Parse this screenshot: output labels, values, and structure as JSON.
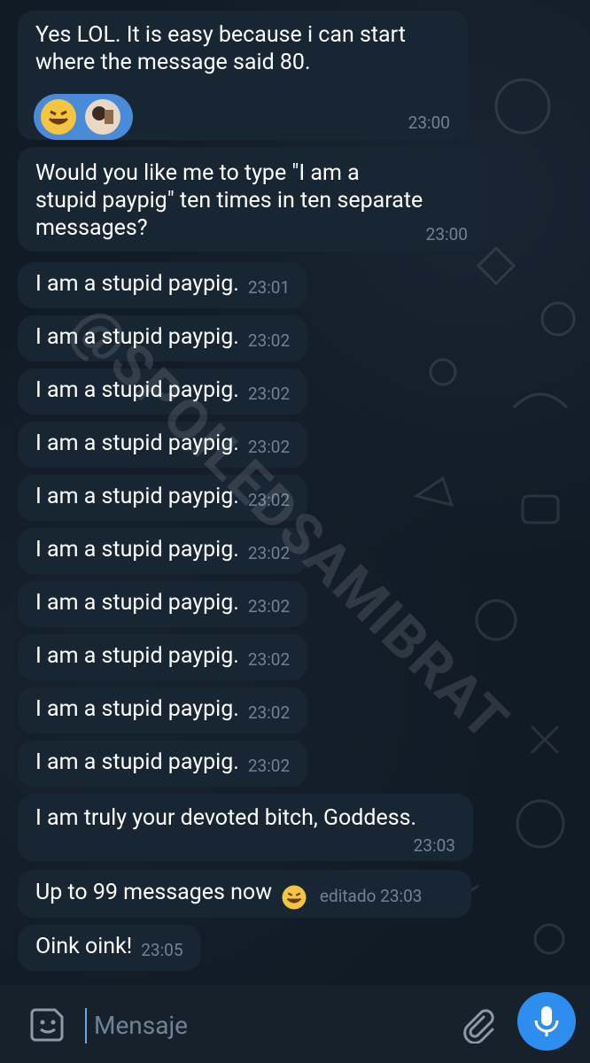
{
  "messages": [
    {
      "text": "Yes LOL. It is easy because i can start\nwhere the message said 80.",
      "time": "23:00"
    },
    {
      "text": "Would you like me to type \"I am a\nstupid paypig\" ten times in ten separate\nmessages?",
      "time": "23:00"
    },
    {
      "text": "I am a stupid paypig.",
      "time": "23:01"
    },
    {
      "text": "I am a stupid paypig.",
      "time": "23:02"
    },
    {
      "text": "I am a stupid paypig.",
      "time": "23:02"
    },
    {
      "text": "I am a stupid paypig.",
      "time": "23:02"
    },
    {
      "text": "I am a stupid paypig.",
      "time": "23:02"
    },
    {
      "text": "I am a stupid paypig.",
      "time": "23:02"
    },
    {
      "text": "I am a stupid paypig.",
      "time": "23:02"
    },
    {
      "text": "I am a stupid paypig.",
      "time": "23:02"
    },
    {
      "text": "I am a stupid paypig.",
      "time": "23:02"
    },
    {
      "text": "I am a stupid paypig.",
      "time": "23:02"
    },
    {
      "text": "I am truly your devoted bitch, Goddess.",
      "time": "23:03"
    },
    {
      "text": "Up to 99 messages now",
      "time": "editado 23:03"
    },
    {
      "text": "Oink oink!",
      "time": "23:05"
    }
  ],
  "watermark": "@SPOILEDSAMIBRAT",
  "input": {
    "placeholder": "Mensaje"
  },
  "icons": {
    "sticker": "sticker-icon",
    "attach": "paperclip-icon",
    "mic": "microphone-icon"
  },
  "colors": {
    "bubble": "#182533",
    "background": "#0e1621",
    "accent": "#2d8ef0",
    "time": "#6f8394"
  }
}
